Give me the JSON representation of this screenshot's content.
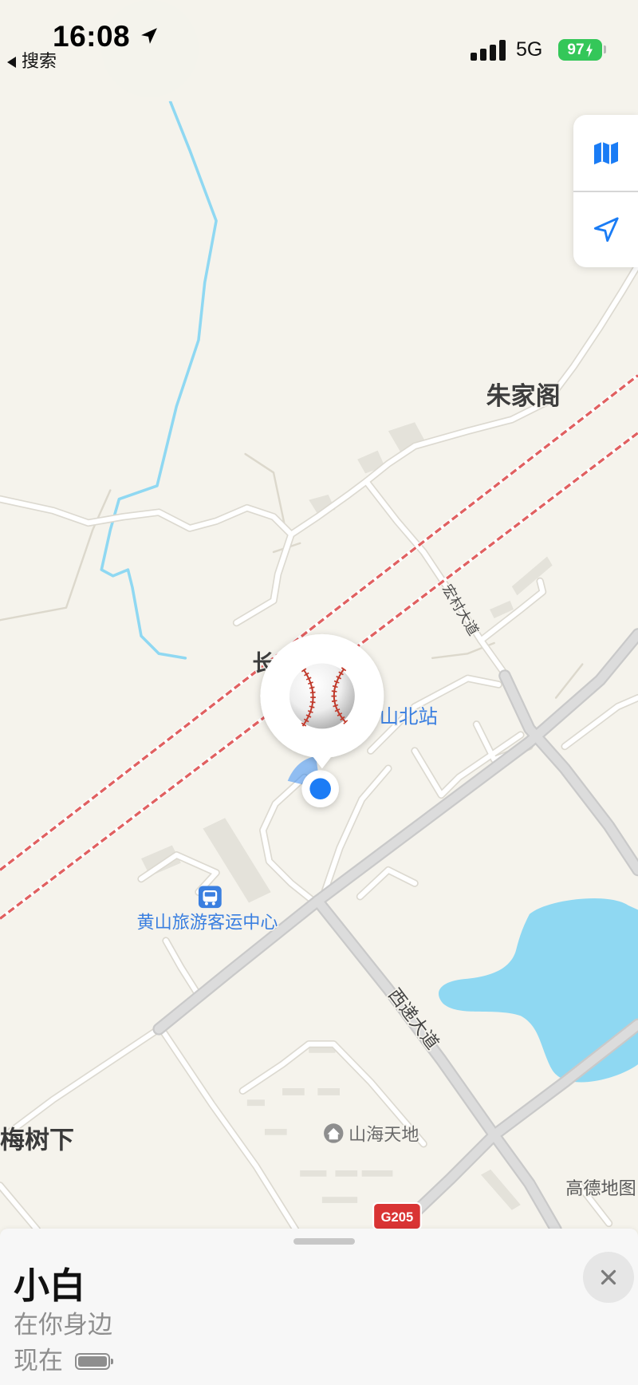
{
  "status_bar": {
    "time": "16:08",
    "location_icon": "location-arrow-icon",
    "back_icon": "back-triangle-icon",
    "back_label": "搜索",
    "signal_icon": "cellular-signal-icon",
    "network": "5G",
    "battery_level": "97",
    "battery_charging_icon": "bolt-icon"
  },
  "map_controls": {
    "map_type_icon": "map-icon",
    "locate_icon": "location-arrow-outline-icon"
  },
  "map": {
    "place_names": [
      "朱家阁",
      "长",
      "梅树下"
    ],
    "road_names": [
      "宏村大道",
      "西递大道"
    ],
    "pois": [
      {
        "name": "山北站"
      },
      {
        "name": "黄山旅游客运中心",
        "icon": "bus-icon"
      },
      {
        "name": "山海天地",
        "icon": "residential-icon"
      }
    ],
    "highway_shield": "G205",
    "attribution": "高德地图"
  },
  "friend_pin": {
    "avatar_icon": "baseball-icon",
    "my_location_icon": "current-location-dot"
  },
  "bottom_sheet": {
    "name": "小白",
    "status": "在你身边",
    "updated": "现在",
    "device_battery_icon": "battery-full-icon",
    "close_icon": "close-icon"
  },
  "colors": {
    "accent_blue": "#1a7cf5",
    "battery_green": "#34c759",
    "poi_blue": "#3a7fe0",
    "water": "#8fd8f2",
    "railway_red": "#e06060",
    "map_background": "#f5f3ec",
    "shield_red": "#d93434"
  }
}
